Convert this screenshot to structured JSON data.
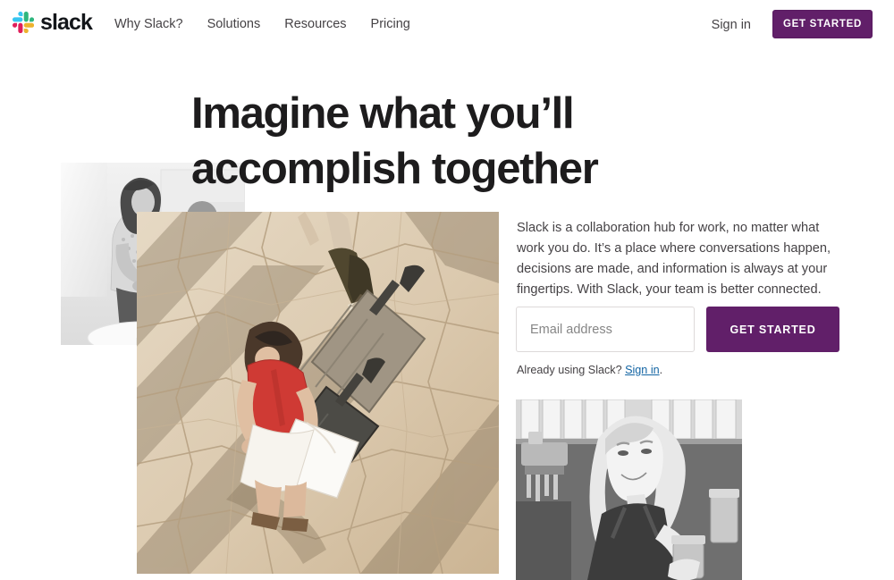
{
  "header": {
    "brand": {
      "word": "slack",
      "logo_icon": "slack-hash-logo"
    },
    "nav_items": [
      {
        "label": "Why Slack?"
      },
      {
        "label": "Solutions"
      },
      {
        "label": "Resources"
      },
      {
        "label": "Pricing"
      }
    ],
    "signin_label": "Sign in",
    "get_started_label": "GET STARTED"
  },
  "hero": {
    "headline": "Imagine what you’ll accomplish together",
    "paragraph": "Slack is a collaboration hub for work, no matter what work you do. It’s a place where conversations happen, decisions are made, and information is always at your fingertips. With Slack, your team is better connected.",
    "email_placeholder": "Email address",
    "email_value": "",
    "get_started_label": "GET STARTED",
    "already_prefix": "Already using Slack? ",
    "already_link": "Sign in",
    "already_suffix": "."
  },
  "images": {
    "office": {
      "alt": "Two colleagues talking in a bright office, black and white"
    },
    "travel": {
      "alt": "Overhead view of travellers with rolling suitcases crossing sunlit stone paving"
    },
    "cafe": {
      "alt": "Smiling cafe worker holding a jar behind the counter, black and white"
    }
  },
  "colors": {
    "aubergine": "#611f69",
    "text_dark": "#1d1c1d",
    "text_muted": "#454245",
    "link_blue": "#1264a3",
    "border_grey": "#ddd9d9",
    "logo_blue": "#36c5f0",
    "logo_green": "#2eb67d",
    "logo_red": "#e01e5a",
    "logo_yellow": "#ecb22e"
  }
}
